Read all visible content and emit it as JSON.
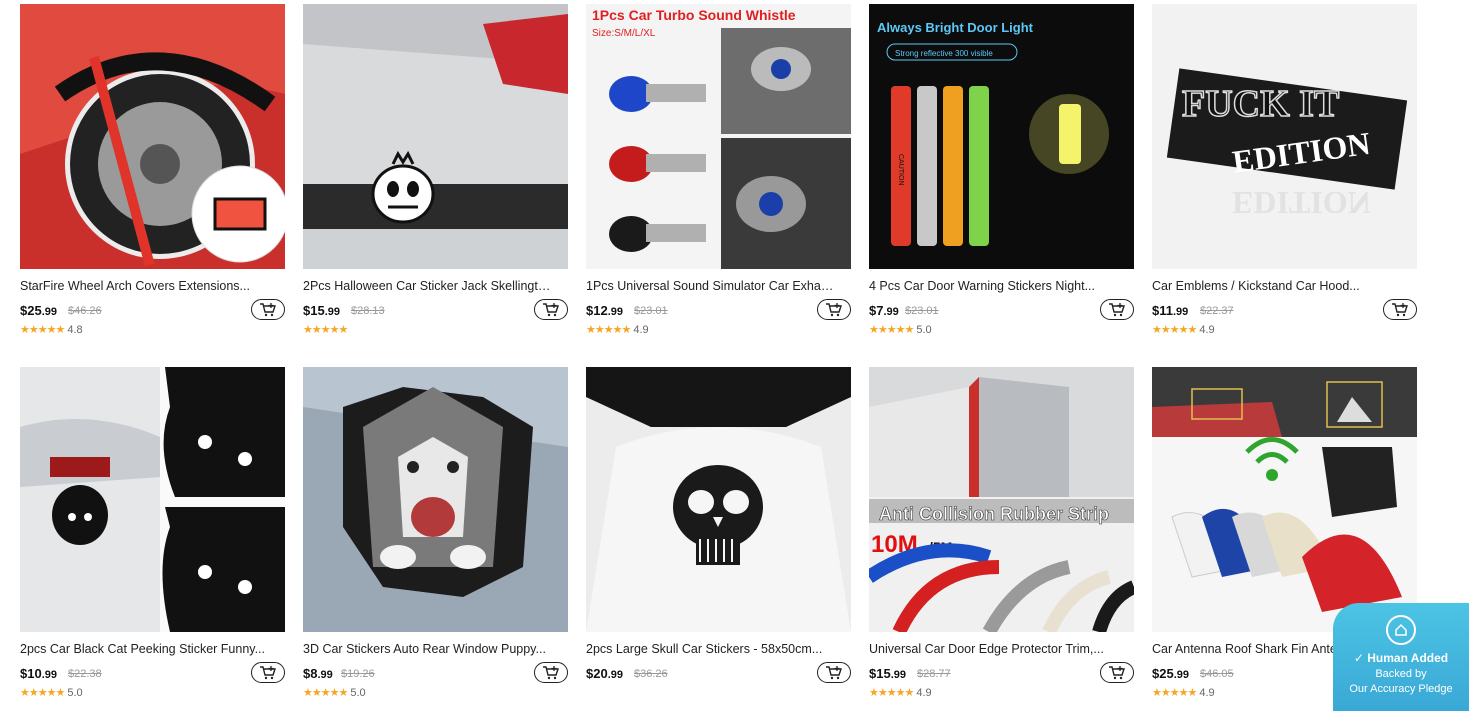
{
  "products": [
    {
      "title": "StarFire Wheel Arch Covers Extensions...",
      "price_dollars": "$25",
      "price_cents": ".99",
      "old_price": "$46.26",
      "stars": "★★★★★",
      "rating": "4.8"
    },
    {
      "title": "2Pcs Halloween Car Sticker Jack Skellington...",
      "price_dollars": "$15",
      "price_cents": ".99",
      "old_price": "$28.13",
      "stars": "★★★★★",
      "rating": ""
    },
    {
      "title": "1Pcs Universal Sound Simulator Car Exhaus...",
      "price_dollars": "$12",
      "price_cents": ".99",
      "old_price": "$23.01",
      "stars": "★★★★★",
      "rating": "4.9"
    },
    {
      "title": "4 Pcs Car Door Warning Stickers Night...",
      "price_dollars": "$7",
      "price_cents": ".99",
      "old_price": "$23.01",
      "stars": "★★★★★",
      "rating": "5.0"
    },
    {
      "title": "Car Emblems / Kickstand Car Hood...",
      "price_dollars": "$11",
      "price_cents": ".99",
      "old_price": "$22.37",
      "stars": "★★★★★",
      "rating": "4.9"
    },
    {
      "title": "2pcs Car Black Cat Peeking Sticker Funny...",
      "price_dollars": "$10",
      "price_cents": ".99",
      "old_price": "$22.38",
      "stars": "★★★★★",
      "rating": "5.0"
    },
    {
      "title": "3D Car Stickers Auto Rear Window Puppy...",
      "price_dollars": "$8",
      "price_cents": ".99",
      "old_price": "$19.26",
      "stars": "★★★★★",
      "rating": "5.0"
    },
    {
      "title": "2pcs Large Skull Car Stickers - 58x50cm...",
      "price_dollars": "$20",
      "price_cents": ".99",
      "old_price": "$36.26",
      "stars": "",
      "rating": ""
    },
    {
      "title": "Universal Car Door Edge Protector Trim,...",
      "price_dollars": "$15",
      "price_cents": ".99",
      "old_price": "$28.77",
      "stars": "★★★★★",
      "rating": "4.9"
    },
    {
      "title": "Car Antenna Roof Shark Fin Antenna Univer...",
      "price_dollars": "$25",
      "price_cents": ".99",
      "old_price": "$46.05",
      "stars": "★★★★★",
      "rating": "4.9"
    }
  ],
  "image_text": {
    "p3_title": "1Pcs Car Turbo Sound Whistle",
    "p3_sizes": "Size:S/M/L/XL",
    "p4_title": "Always Bright Door Light",
    "p4_sub": "Strong reflective 300 visible",
    "p4_caution": "CAUTION",
    "p5_line1": "FUCK IT",
    "p5_line2": "EDITION",
    "p9_banner": "Anti Collision Rubber Strip",
    "p9_len1": "10M",
    "p9_len2": "/5M"
  },
  "badge": {
    "line1": "Human Added",
    "line2": "Backed by",
    "line3": "Our Accuracy Pledge"
  },
  "colors": {
    "accent_star": "#f5a623",
    "badge_bg": "#3aa8d6"
  }
}
